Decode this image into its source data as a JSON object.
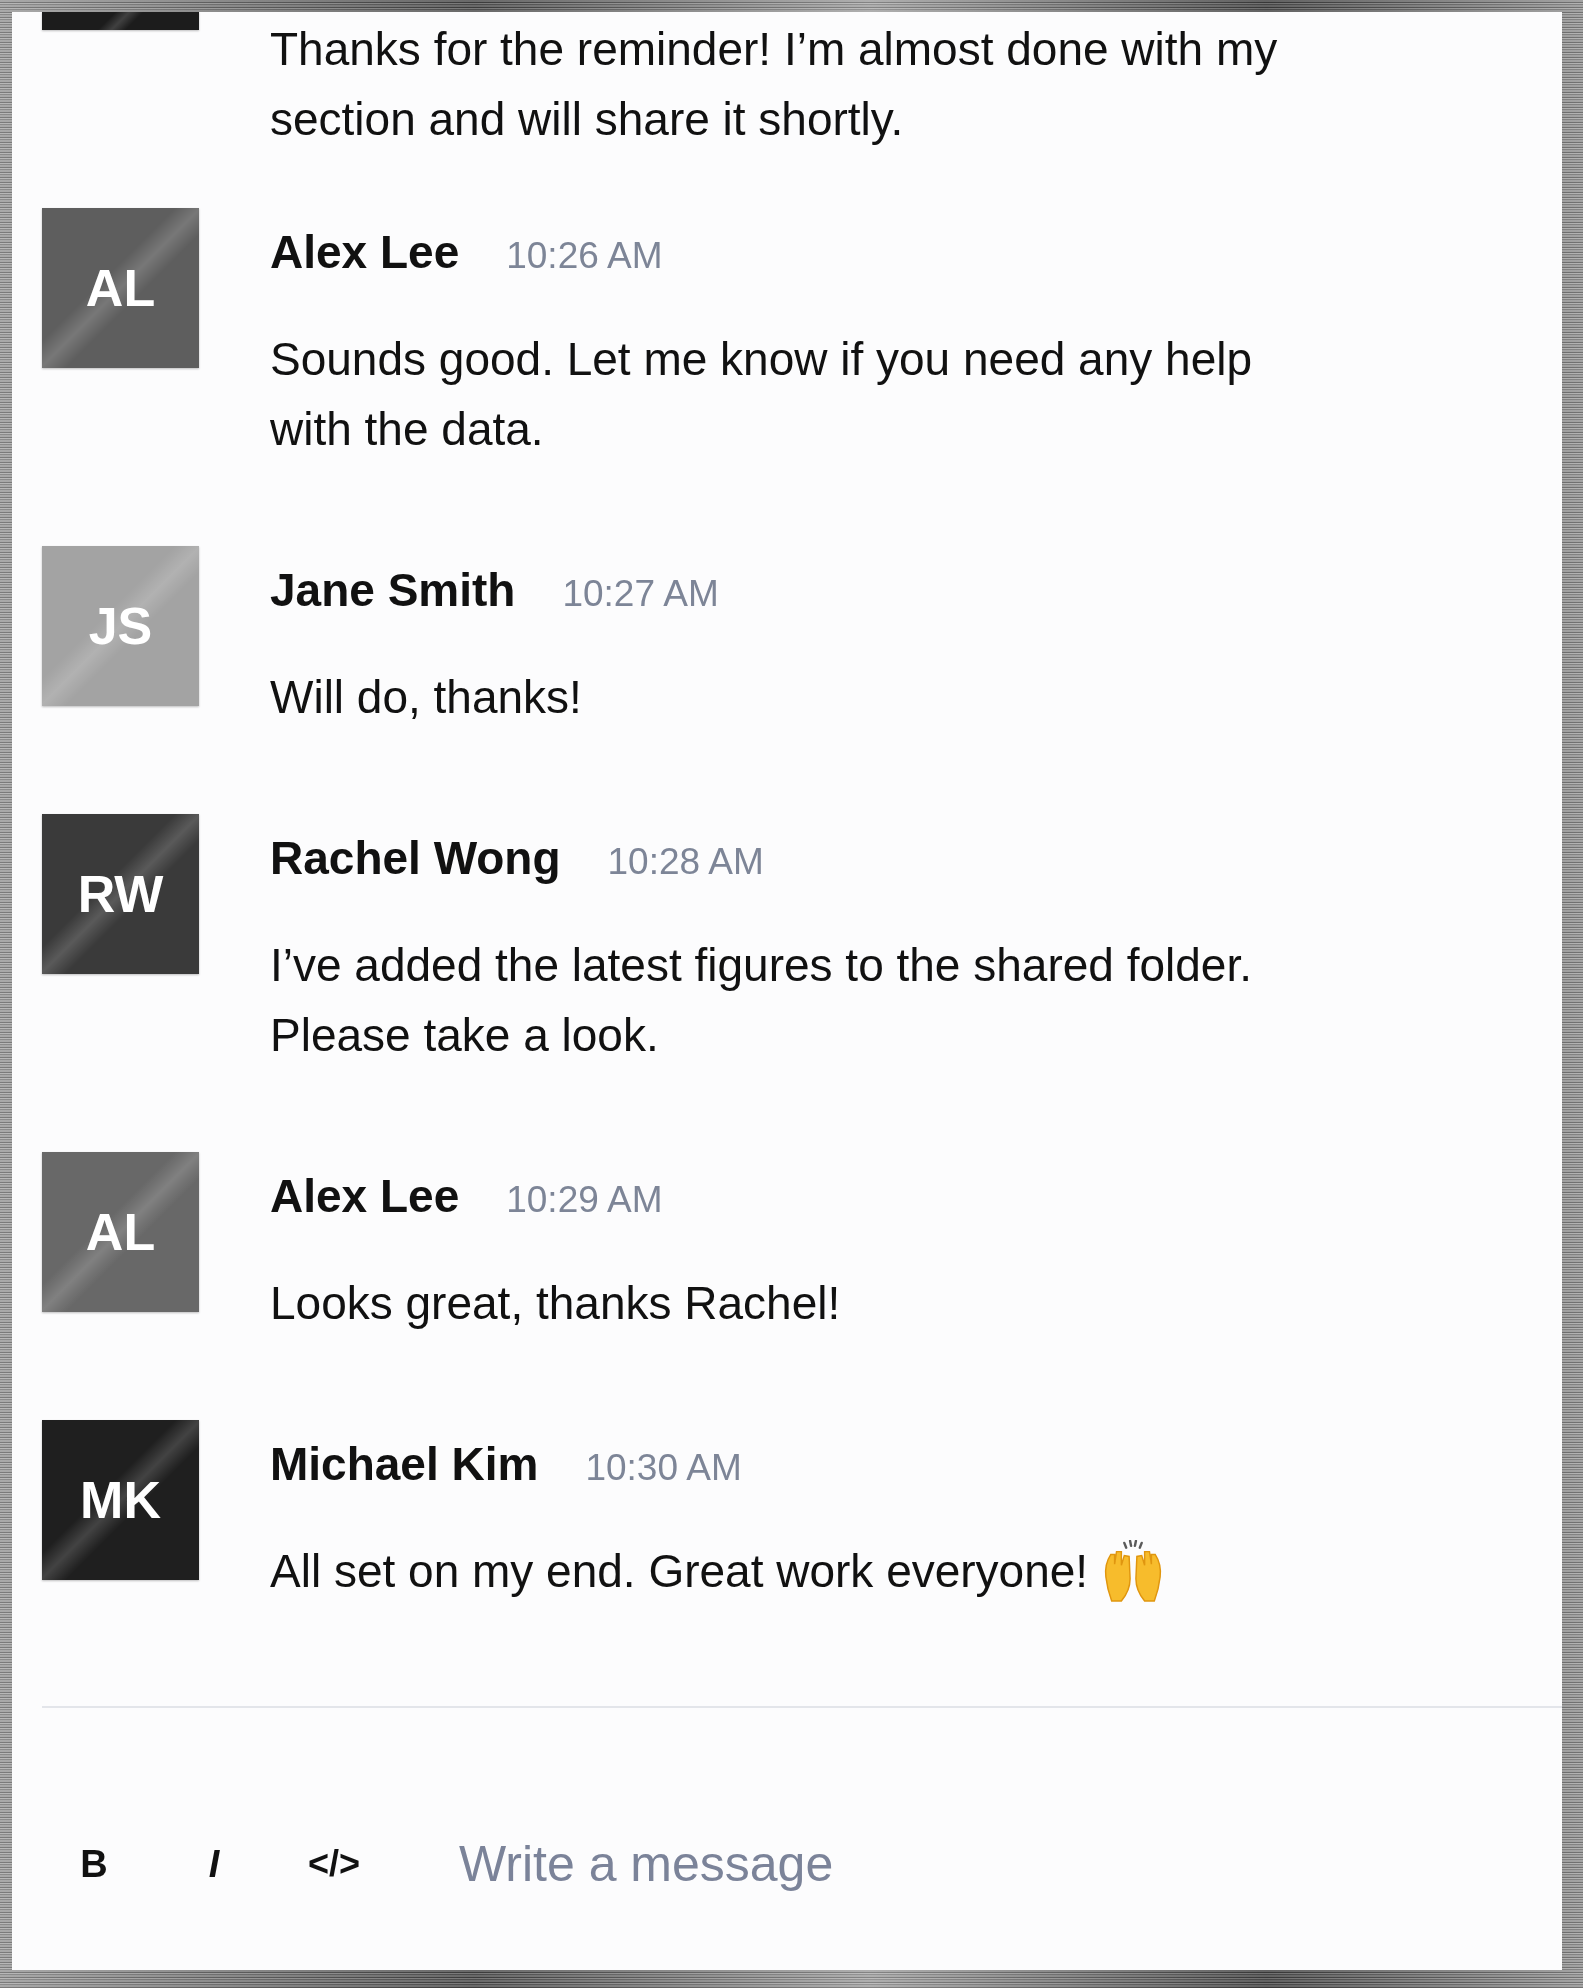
{
  "messages": [
    {
      "kind": "partial",
      "color": "#1c1c1c",
      "text": "Thanks for the reminder! I’m almost done with my section and will share it shortly.",
      "trailing_emoji": false
    },
    {
      "kind": "full",
      "initials": "AL",
      "color": "#5e5e5e",
      "name": "Alex Lee",
      "time": "10:26 AM",
      "text": "Sounds good. Let me know if you need any help with the data.",
      "trailing_emoji": false
    },
    {
      "kind": "full",
      "initials": "JS",
      "color": "#a3a3a3",
      "name": "Jane Smith",
      "time": "10:27 AM",
      "text": "Will do, thanks!",
      "trailing_emoji": false
    },
    {
      "kind": "full",
      "initials": "RW",
      "color": "#3a3a3a",
      "name": "Rachel Wong",
      "time": "10:28 AM",
      "text": "I’ve added the latest figures to the shared folder. Please take a look.",
      "trailing_emoji": false
    },
    {
      "kind": "full",
      "initials": "AL",
      "color": "#686868",
      "name": "Alex Lee",
      "time": "10:29 AM",
      "text": "Looks great, thanks Rachel!",
      "trailing_emoji": false
    },
    {
      "kind": "full",
      "initials": "MK",
      "color": "#1f1f1f",
      "name": "Michael Kim",
      "time": "10:30 AM",
      "text": "All set on my end. Great work everyone!",
      "trailing_emoji": true
    }
  ],
  "composer": {
    "tools": [
      {
        "kind": "bold",
        "label": "B"
      },
      {
        "kind": "italic",
        "label": "I"
      },
      {
        "kind": "code",
        "label": "</>"
      }
    ],
    "placeholder": "Write a message"
  }
}
